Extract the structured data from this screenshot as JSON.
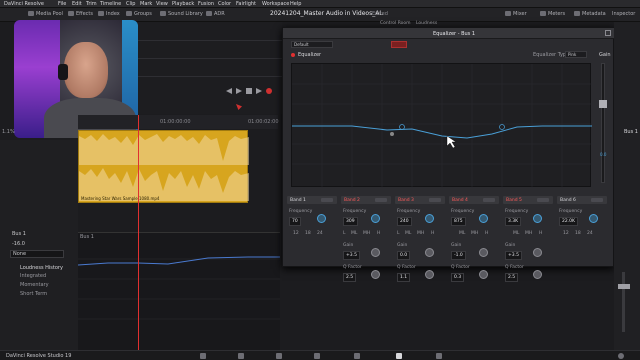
{
  "menubar": {
    "items": [
      "DaVinci Resolve",
      "File",
      "Edit",
      "Trim",
      "Timeline",
      "Clip",
      "Mark",
      "View",
      "Playback",
      "Fusion",
      "Color",
      "Fairlight",
      "Workspace",
      "Help"
    ]
  },
  "toolbar": {
    "left_items": [
      "Media Pool",
      "Effects",
      "Index",
      "Groups",
      "Sound Library",
      "ADR"
    ],
    "project_title": "20241204_Master Audio in Videos_AL",
    "edited": "Edited",
    "right_items": [
      "Mixer",
      "Meters",
      "Metadata",
      "Inspector"
    ],
    "room_tabs": [
      "Control Room",
      "Loudness"
    ]
  },
  "timeline": {
    "clip_label": "Mastering Star Wars Sample 1080.mp4",
    "bus_label": "Bus 1",
    "timecodes": [
      "01:00:00:00",
      "01:00:02:00"
    ]
  },
  "leftpanel": {
    "track_name": "Bus 1",
    "value": "-16.0",
    "dropdown": "None",
    "loudness_title": "Loudness History",
    "options": [
      "Integrated",
      "Momentary",
      "Short Term"
    ]
  },
  "eq": {
    "window_title": "Equalizer - Bus 1",
    "preset": "Default",
    "section_label": "Equalizer",
    "type_label": "Equalizer Type",
    "type_value": "Pink",
    "gain_label": "Gain",
    "gain_value": "0.0",
    "bands": [
      {
        "name": "Band 1",
        "freq": "70",
        "gain": null,
        "q": null,
        "modes": [
          "12",
          "18",
          "24"
        ],
        "active": false
      },
      {
        "name": "Band 2",
        "freq": "309",
        "gain": "+3.5",
        "q": "2.5",
        "modes": [
          "L",
          "ML",
          "MH",
          "H"
        ],
        "active": true
      },
      {
        "name": "Band 3",
        "freq": "240",
        "gain": "0.0",
        "q": "1.1",
        "modes": [
          "L",
          "ML",
          "MH",
          "H"
        ],
        "active": true
      },
      {
        "name": "Band 4",
        "freq": "875",
        "gain": "-1.0",
        "q": "0.3",
        "modes": [
          "ML",
          "MH",
          "H"
        ],
        "active": true
      },
      {
        "name": "Band 5",
        "freq": "3.3K",
        "gain": "+3.5",
        "q": "2.5",
        "modes": [
          "ML",
          "MH",
          "H"
        ],
        "active": true
      },
      {
        "name": "Band 6",
        "freq": "22.0K",
        "gain": null,
        "q": null,
        "modes": [
          "12",
          "18",
          "24"
        ],
        "active": false
      }
    ],
    "freq_label": "Frequency",
    "gain_row_label": "Gain",
    "q_label": "Q Factor",
    "accent_color": "#4aa0d8"
  },
  "footer": {
    "app": "DaVinci Resolve Studio 19"
  }
}
